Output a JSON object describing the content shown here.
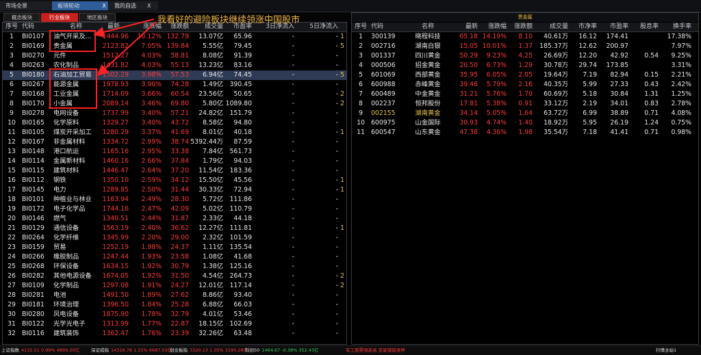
{
  "top_tabs": [
    {
      "label": "市场全景"
    },
    {
      "label": "板块轮动"
    },
    {
      "label": "我的自选"
    }
  ],
  "sub_tabs": [
    {
      "label": "概念板块"
    },
    {
      "label": "行业板块"
    },
    {
      "label": "地区板块"
    }
  ],
  "annotation": "我看好的避险板块继续领涨中国股市",
  "left_panel": {
    "headers": [
      "序号",
      "代码",
      "名称",
      "最新",
      "涨跌幅",
      "涨跌额",
      "成交量",
      "市盈率",
      "3日净流入",
      "5日净流入"
    ],
    "rows": [
      [
        "1",
        "BI0107",
        "油气开采及…",
        "1444.96",
        "10.12%",
        "132.79",
        "13.07亿",
        "65.96",
        "-",
        "-"
      ],
      [
        "2",
        "BI0169",
        "贵金属",
        "2123.82",
        "7.05%",
        "139.84",
        "5.55亿",
        "79.45",
        "-",
        "-"
      ],
      [
        "3",
        "BI0270",
        "元件",
        "1512.27",
        "4.03%",
        "58.81",
        "8.08亿",
        "91.39",
        "-",
        "-"
      ],
      [
        "4",
        "BI0263",
        "农化制品",
        "1431.82",
        "4.03%",
        "55.13",
        "13.23亿",
        "83.16",
        "-",
        "-"
      ],
      [
        "5",
        "BI0180",
        "石油加工贸易",
        "1502.29",
        "3.98%",
        "57.53",
        "6.94亿",
        "74.45",
        "-",
        "-"
      ],
      [
        "6",
        "BI0267",
        "能源金属",
        "1978.93",
        "3.90%",
        "74.28",
        "1.49亿",
        "390.45",
        "-",
        "-"
      ],
      [
        "7",
        "BI0168",
        "工业金属",
        "1714.09",
        "3.66%",
        "60.54",
        "23.56亿",
        "50.65",
        "-",
        "-"
      ],
      [
        "8",
        "BI0170",
        "小金属",
        "2089.14",
        "3.46%",
        "69.80",
        "5.80亿",
        "1089.80",
        "-",
        "-"
      ],
      [
        "9",
        "BI0278",
        "电网设备",
        "1737.99",
        "3.40%",
        "57.21",
        "24.82亿",
        "151.79",
        "-",
        "-"
      ],
      [
        "10",
        "BI0165",
        "化学原料",
        "1329.27",
        "3.40%",
        "43.72",
        "8.58亿",
        "94.80",
        "-",
        "-"
      ],
      [
        "11",
        "BI0105",
        "煤炭开采加工",
        "1280.29",
        "3.37%",
        "41.69",
        "8.01亿",
        "40.18",
        "-",
        "-"
      ],
      [
        "12",
        "BI0167",
        "非金属材料",
        "1334.72",
        "2.99%",
        "38.74",
        "5392.44万",
        "87.59",
        "-",
        "-"
      ],
      [
        "13",
        "BI0148",
        "港口航运",
        "1165.16",
        "2.95%",
        "33.38",
        "7.84亿",
        "561.73",
        "-",
        "-"
      ],
      [
        "14",
        "BI0114",
        "金属新材料",
        "1460.16",
        "2.66%",
        "37.84",
        "1.79亿",
        "94.03",
        "-",
        "-"
      ],
      [
        "15",
        "BI0115",
        "建筑材料",
        "1446.47",
        "2.64%",
        "37.20",
        "11.54亿",
        "183.36",
        "-",
        "-"
      ],
      [
        "16",
        "BI0112",
        "钢铁",
        "1350.10",
        "2.59%",
        "34.12",
        "15.50亿",
        "45.56",
        "-",
        "-"
      ],
      [
        "17",
        "BI0145",
        "电力",
        "1289.85",
        "2.50%",
        "31.44",
        "30.33亿",
        "72.94",
        "-",
        "-"
      ],
      [
        "18",
        "BI0101",
        "种植业与林业",
        "1163.94",
        "2.49%",
        "28.30",
        "5.72亿",
        "111.86",
        "-",
        "-"
      ],
      [
        "19",
        "BI0172",
        "电子化学品",
        "1744.16",
        "2.47%",
        "42.09",
        "5.02亿",
        "110.79",
        "-",
        "-"
      ],
      [
        "20",
        "BI0146",
        "燃气",
        "1340.51",
        "2.44%",
        "31.87",
        "2.33亿",
        "44.18",
        "-",
        "-"
      ],
      [
        "21",
        "BI0129",
        "通信设备",
        "1563.19",
        "2.40%",
        "36.62",
        "12.27亿",
        "111.81",
        "-",
        "-"
      ],
      [
        "22",
        "BI0264",
        "化学纤维",
        "1345.99",
        "2.20%",
        "29.00",
        "2.32亿",
        "101.59",
        "-",
        "-"
      ],
      [
        "23",
        "BI0159",
        "贸易",
        "1252.19",
        "1.98%",
        "24.37",
        "1.11亿",
        "135.54",
        "-",
        "-"
      ],
      [
        "24",
        "BI0266",
        "橡胶制品",
        "1247.44",
        "1.93%",
        "23.58",
        "1.08亿",
        "41.68",
        "-",
        "-"
      ],
      [
        "25",
        "BI0268",
        "环保设备",
        "1634.15",
        "1.92%",
        "30.79",
        "1.38亿",
        "125.16",
        "-",
        "-"
      ],
      [
        "26",
        "BI0282",
        "其他电源设备",
        "1674.05",
        "1.92%",
        "31.50",
        "4.54亿",
        "264.73",
        "-",
        "-"
      ],
      [
        "27",
        "BI0109",
        "化学制品",
        "1297.08",
        "1.91%",
        "24.27",
        "12.01亿",
        "117.14",
        "-",
        "-"
      ],
      [
        "28",
        "BI0281",
        "电池",
        "1491.50",
        "1.89%",
        "27.62",
        "8.86亿",
        "93.40",
        "-",
        "-"
      ],
      [
        "29",
        "BI0181",
        "环境治理",
        "1396.50",
        "1.84%",
        "25.28",
        "6.88亿",
        "66.03",
        "-",
        "-"
      ],
      [
        "30",
        "BI0280",
        "风电设备",
        "1875.90",
        "1.78%",
        "32.79",
        "4.01亿",
        "53.46",
        "-",
        "-"
      ],
      [
        "31",
        "BI0122",
        "光学光电子",
        "1313.99",
        "1.77%",
        "22.87",
        "18.15亿",
        "102.69",
        "-",
        "-"
      ],
      [
        "32",
        "BI0116",
        "建筑装饰",
        "1362.47",
        "1.76%",
        "23.39",
        "32.26亿",
        "63.48",
        "-",
        "-"
      ]
    ],
    "right_edge": [
      "1",
      "5",
      "",
      "",
      "5",
      "",
      "2",
      "2",
      "",
      "",
      "1",
      "",
      "",
      "",
      "",
      "1",
      "1",
      "",
      "",
      "",
      "1",
      "",
      "",
      "",
      "",
      "2",
      "2",
      "",
      "",
      "",
      "",
      ""
    ]
  },
  "right_panel": {
    "title": "贵金属",
    "headers": [
      "序号",
      "代码",
      "名称",
      "最新",
      "涨跌幅",
      "涨跌额",
      "成交量",
      "市净率",
      "市盈率",
      "股息率",
      "换手率"
    ],
    "rows": [
      [
        "1",
        "300139",
        "晓程科技",
        "65.18",
        "14.19%",
        "8.10",
        "40.61万",
        "16.12",
        "174.41",
        "",
        "17.38%"
      ],
      [
        "2",
        "002716",
        "湖南白银",
        "15.05",
        "10.01%",
        "1.37",
        "185.37万",
        "12.62",
        "200.97",
        "",
        "7.97%"
      ],
      [
        "3",
        "001337",
        "四川黄金",
        "50.29",
        "9.23%",
        "4.25",
        "26.69万",
        "12.20",
        "42.92",
        "0.54",
        "9.25%"
      ],
      [
        "4",
        "000506",
        "招金黄金",
        "20.50",
        "6.73%",
        "1.29",
        "30.78万",
        "29.74",
        "173.85",
        "",
        "3.31%"
      ],
      [
        "5",
        "601069",
        "西部黄金",
        "35.95",
        "6.05%",
        "2.05",
        "19.64万",
        "7.19",
        "82.94",
        "0.15",
        "2.21%"
      ],
      [
        "6",
        "600988",
        "赤峰黄金",
        "39.46",
        "5.79%",
        "2.16",
        "40.35万",
        "5.99",
        "27.33",
        "0.43",
        "2.42%"
      ],
      [
        "7",
        "600489",
        "中金黄金",
        "31.21",
        "5.76%",
        "1.70",
        "60.69万",
        "5.18",
        "30.84",
        "1.31",
        "1.25%"
      ],
      [
        "8",
        "002237",
        "恒邦股份",
        "17.81",
        "5.38%",
        "0.91",
        "33.12万",
        "2.19",
        "34.01",
        "0.83",
        "2.78%"
      ],
      [
        "9",
        "002155",
        "湖南黄金",
        "34.14",
        "5.05%",
        "1.64",
        "63.72万",
        "6.99",
        "38.89",
        "0.71",
        "4.08%"
      ],
      [
        "10",
        "600975",
        "山金国际",
        "30.93",
        "4.74%",
        "1.40",
        "18.92万",
        "5.95",
        "26.19",
        "1.24",
        "0.75%"
      ],
      [
        "11",
        "600547",
        "山东黄金",
        "47.38",
        "4.36%",
        "1.98",
        "35.54万",
        "7.18",
        "41.41",
        "0.71",
        "0.98%"
      ]
    ]
  },
  "status_bar": [
    {
      "label": "上证指数",
      "value": "4132.51 0.99% 4899.30亿"
    },
    {
      "label": "深证成指",
      "value": "14316.78 1.55% 6687.03亿"
    },
    {
      "label": "创业板指",
      "value": "3320.13 1.35% 3190.28亿"
    },
    {
      "label": "科创50",
      "value": "1464.67 -0.38% 352.43亿"
    },
    {
      "label": "",
      "value": "军工股票强走高 亚星锚链涨停"
    },
    {
      "label": "",
      "value": "行情主站1"
    }
  ],
  "colors": {
    "up": "#ff3a3a",
    "active_tab": "#c8201e",
    "annotation": "#f2b648",
    "box": "#ff2222"
  }
}
